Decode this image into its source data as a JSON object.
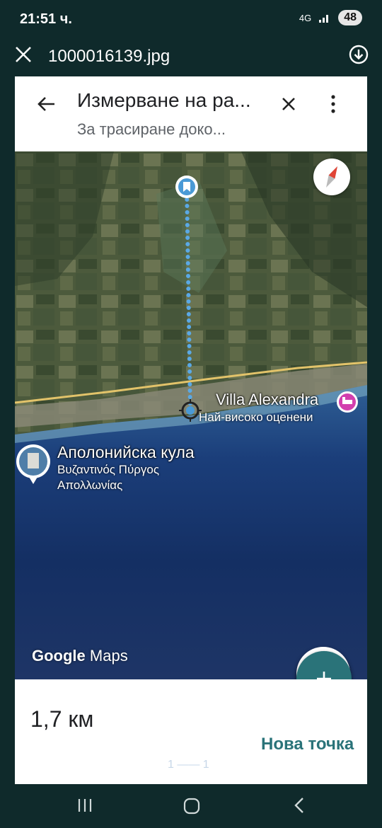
{
  "status_bar": {
    "time": "21:51 ч.",
    "network": "4G",
    "battery": "48"
  },
  "viewer": {
    "filename": "1000016139.jpg"
  },
  "maps_header": {
    "title": "Измерване на ра...",
    "subtitle": "За трасиране доко..."
  },
  "map": {
    "places": [
      {
        "name": "Villa Alexandra",
        "subtitle": "Най-високо оценени"
      },
      {
        "name": "Аполонийска кула",
        "subtitle_line1": "Βυζαντινός Πύργος",
        "subtitle_line2": "Απολλωνίας"
      }
    ],
    "logo": {
      "google": "Google",
      "maps": "Maps"
    }
  },
  "bottom": {
    "distance": "1,7 км",
    "add_point": "Нова точка",
    "scale_hint": "1 —— 1"
  },
  "colors": {
    "accent": "#2a7379",
    "route_dot": "#5aa9e6",
    "hotel_pin": "#d23fae"
  },
  "icons": [
    "close-icon",
    "download-icon",
    "back-arrow-icon",
    "close-icon",
    "more-vert-icon",
    "compass-icon",
    "my-location-icon",
    "add-icon",
    "recent-apps-icon",
    "home-icon",
    "back-nav-icon"
  ]
}
